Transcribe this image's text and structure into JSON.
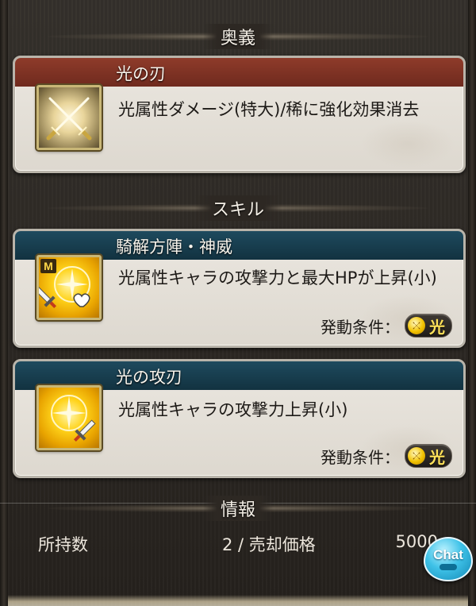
{
  "sections": {
    "ougi": "奥義",
    "skill": "スキル",
    "info": "情報"
  },
  "ougi": {
    "name": "光の刃",
    "description": "光属性ダメージ(特大)/稀に強化効果消去",
    "icon": "crossed-swords-icon"
  },
  "skills": [
    {
      "name": "騎解方陣・神威",
      "description": "光属性キャラの攻撃力と最大HPが上昇(小)",
      "icon": "light-compass-sword-heart-icon",
      "badge": "M",
      "condition_label": "発動条件：",
      "condition_element": "光"
    },
    {
      "name": "光の攻刃",
      "description": "光属性キャラの攻撃力上昇(小)",
      "icon": "light-compass-sword-icon",
      "condition_label": "発動条件：",
      "condition_element": "光"
    }
  ],
  "info": {
    "owned_label": "所持数",
    "middle_text": "2 / 売却価格",
    "price": "5000"
  },
  "chat": {
    "label": "Chat"
  },
  "colors": {
    "ougi_header": "#7a3324",
    "skill_header": "#173d4f",
    "element_light": "#ffd31a"
  }
}
